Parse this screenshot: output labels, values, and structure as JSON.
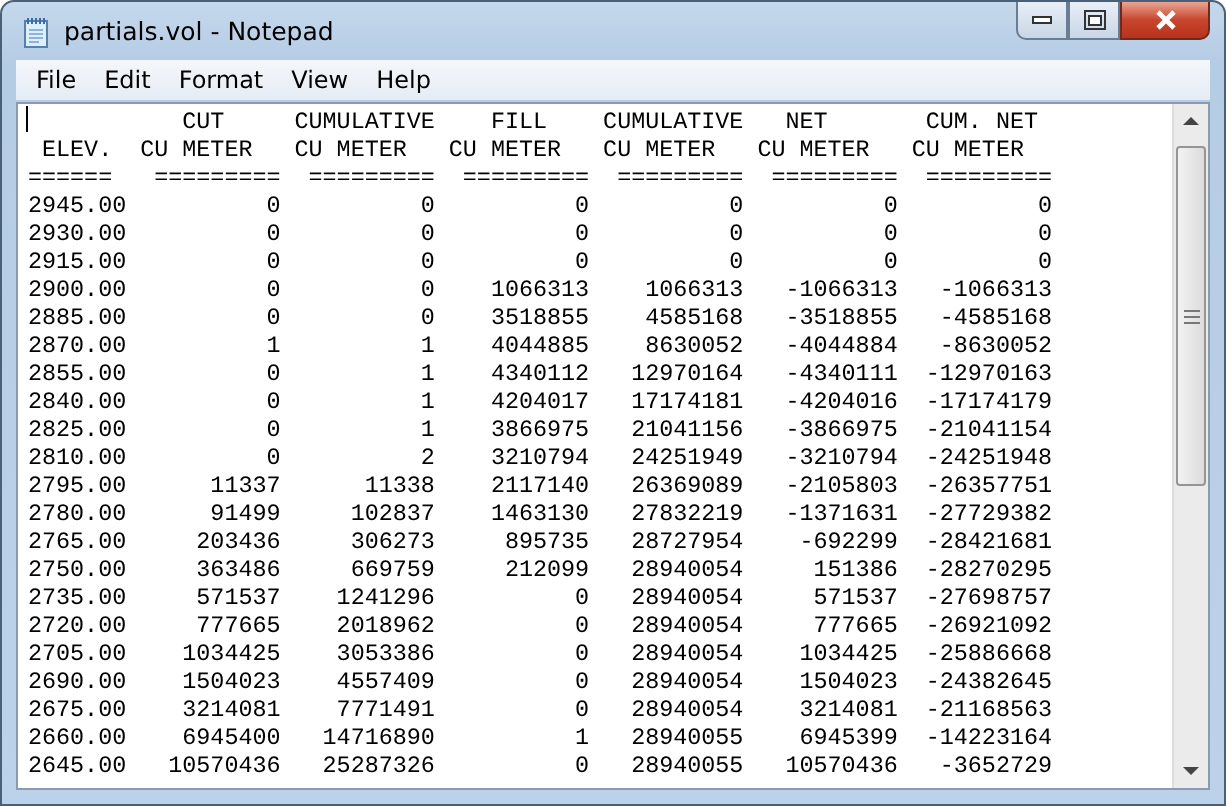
{
  "window": {
    "title": "partials.vol - Notepad"
  },
  "menu": [
    {
      "label": "File"
    },
    {
      "label": "Edit"
    },
    {
      "label": "Format"
    },
    {
      "label": "View"
    },
    {
      "label": "Help"
    }
  ],
  "document": {
    "header_lines": [
      "           CUT     CUMULATIVE    FILL    CUMULATIVE   NET       CUM. NET",
      " ELEV.  CU METER   CU METER   CU METER   CU METER   CU METER   CU METER",
      "======   =========  =========  =========  =========  =========  ========="
    ],
    "rows": [
      [
        "2945.00",
        "0",
        "0",
        "0",
        "0",
        "0",
        "0"
      ],
      [
        "2930.00",
        "0",
        "0",
        "0",
        "0",
        "0",
        "0"
      ],
      [
        "2915.00",
        "0",
        "0",
        "0",
        "0",
        "0",
        "0"
      ],
      [
        "2900.00",
        "0",
        "0",
        "1066313",
        "1066313",
        "-1066313",
        "-1066313"
      ],
      [
        "2885.00",
        "0",
        "0",
        "3518855",
        "4585168",
        "-3518855",
        "-4585168"
      ],
      [
        "2870.00",
        "1",
        "1",
        "4044885",
        "8630052",
        "-4044884",
        "-8630052"
      ],
      [
        "2855.00",
        "0",
        "1",
        "4340112",
        "12970164",
        "-4340111",
        "-12970163"
      ],
      [
        "2840.00",
        "0",
        "1",
        "4204017",
        "17174181",
        "-4204016",
        "-17174179"
      ],
      [
        "2825.00",
        "0",
        "1",
        "3866975",
        "21041156",
        "-3866975",
        "-21041154"
      ],
      [
        "2810.00",
        "0",
        "2",
        "3210794",
        "24251949",
        "-3210794",
        "-24251948"
      ],
      [
        "2795.00",
        "11337",
        "11338",
        "2117140",
        "26369089",
        "-2105803",
        "-26357751"
      ],
      [
        "2780.00",
        "91499",
        "102837",
        "1463130",
        "27832219",
        "-1371631",
        "-27729382"
      ],
      [
        "2765.00",
        "203436",
        "306273",
        "895735",
        "28727954",
        "-692299",
        "-28421681"
      ],
      [
        "2750.00",
        "363486",
        "669759",
        "212099",
        "28940054",
        "151386",
        "-28270295"
      ],
      [
        "2735.00",
        "571537",
        "1241296",
        "0",
        "28940054",
        "571537",
        "-27698757"
      ],
      [
        "2720.00",
        "777665",
        "2018962",
        "0",
        "28940054",
        "777665",
        "-26921092"
      ],
      [
        "2705.00",
        "1034425",
        "3053386",
        "0",
        "28940054",
        "1034425",
        "-25886668"
      ],
      [
        "2690.00",
        "1504023",
        "4557409",
        "0",
        "28940054",
        "1504023",
        "-24382645"
      ],
      [
        "2675.00",
        "3214081",
        "7771491",
        "0",
        "28940054",
        "3214081",
        "-21168563"
      ],
      [
        "2660.00",
        "6945400",
        "14716890",
        "1",
        "28940055",
        "6945399",
        "-14223164"
      ],
      [
        "2645.00",
        "10570436",
        "25287326",
        "0",
        "28940055",
        "10570436",
        "-3652729"
      ]
    ]
  }
}
